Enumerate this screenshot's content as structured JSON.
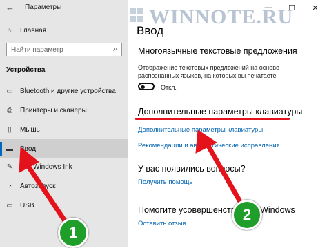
{
  "window": {
    "title": "Параметры",
    "back_glyph": "←",
    "minimize_glyph": "—",
    "maximize_glyph": "☐",
    "close_glyph": "✕"
  },
  "watermark": {
    "text": "WINNOTE.RU"
  },
  "sidebar": {
    "home": {
      "label": "Главная",
      "icon": "home-icon"
    },
    "search_placeholder": "Найти параметр",
    "search_icon": "search-icon",
    "category": "Устройства",
    "items": [
      {
        "label": "Bluetooth и другие устройства",
        "icon": "bluetooth-icon",
        "selected": false
      },
      {
        "label": "Принтеры и сканеры",
        "icon": "printer-icon",
        "selected": false
      },
      {
        "label": "Мышь",
        "icon": "mouse-icon",
        "selected": false
      },
      {
        "label": "Ввод",
        "icon": "keyboard-icon",
        "selected": true
      },
      {
        "label": "Windows Ink",
        "icon": "pen-icon",
        "selected": false
      },
      {
        "label": "Автозапуск",
        "icon": "autoplay-icon",
        "selected": false
      },
      {
        "label": "USB",
        "icon": "usb-icon",
        "selected": false
      }
    ]
  },
  "main": {
    "title": "Ввод",
    "multilingual": {
      "heading": "Многоязычные текстовые предложения",
      "description": "Отображение текстовых предложений на основе распознанных языков, на которых вы печатаете",
      "toggle_state": "Откл."
    },
    "keyboard": {
      "heading": "Дополнительные параметры клавиатуры",
      "link": "Дополнительные параметры клавиатуры",
      "link2": "Рекомендации и автоматические исправления"
    },
    "questions": {
      "heading": "У вас появились вопросы?",
      "link": "Получить помощь"
    },
    "improve": {
      "heading": "Помогите усовершенствовать Windows",
      "link": "Оставить отзыв"
    }
  },
  "annotations": {
    "badge1": "1",
    "badge2": "2",
    "arrow_color": "#e4131b",
    "badge_color": "#1f9e2a"
  }
}
